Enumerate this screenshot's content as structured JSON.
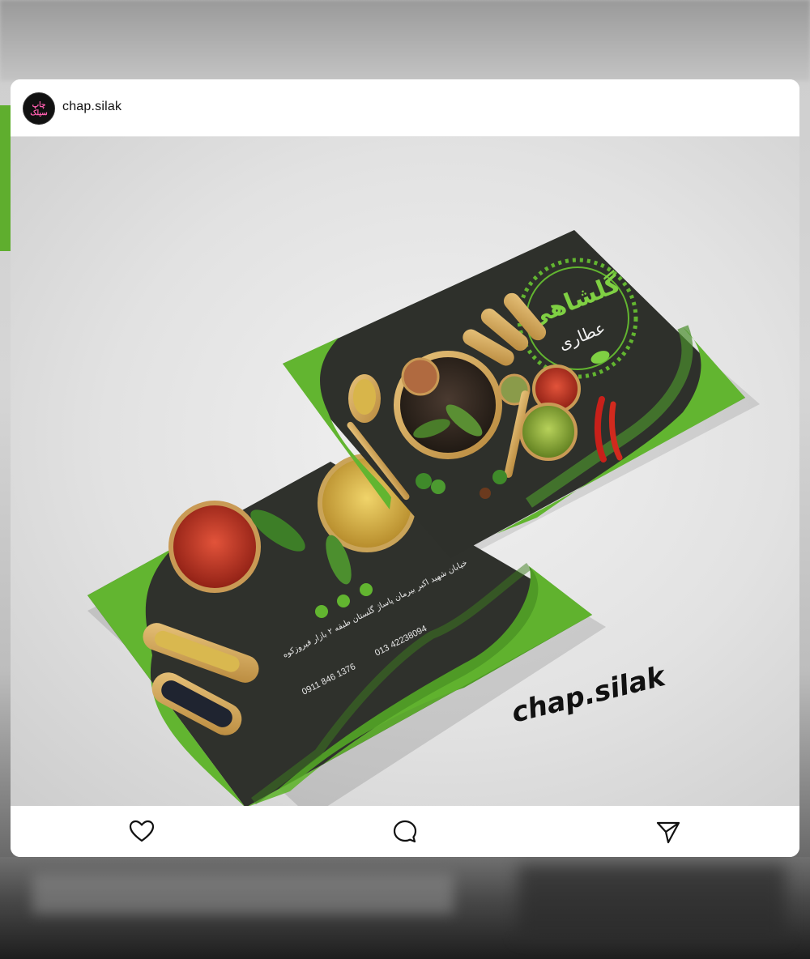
{
  "post": {
    "username": "chap.silak",
    "avatar_text": "چاپ سیلک"
  },
  "image": {
    "watermark": "chap.silak",
    "front_card": {
      "brand_name": "گلشاهی",
      "brand_subtitle": "عطاری",
      "colors": {
        "card": "#2e302b",
        "accent": "#62b530"
      }
    },
    "back_card": {
      "address": "خیابان شهید اکبر بیرمان پاساژ گلستان طبقه ۲ بازار فیروزکوه",
      "phone_office": "013 42238094",
      "phone_mobile": "0911 846 1376"
    }
  },
  "actions": {
    "like": "heart-icon",
    "comment": "comment-icon",
    "share": "send-icon"
  }
}
